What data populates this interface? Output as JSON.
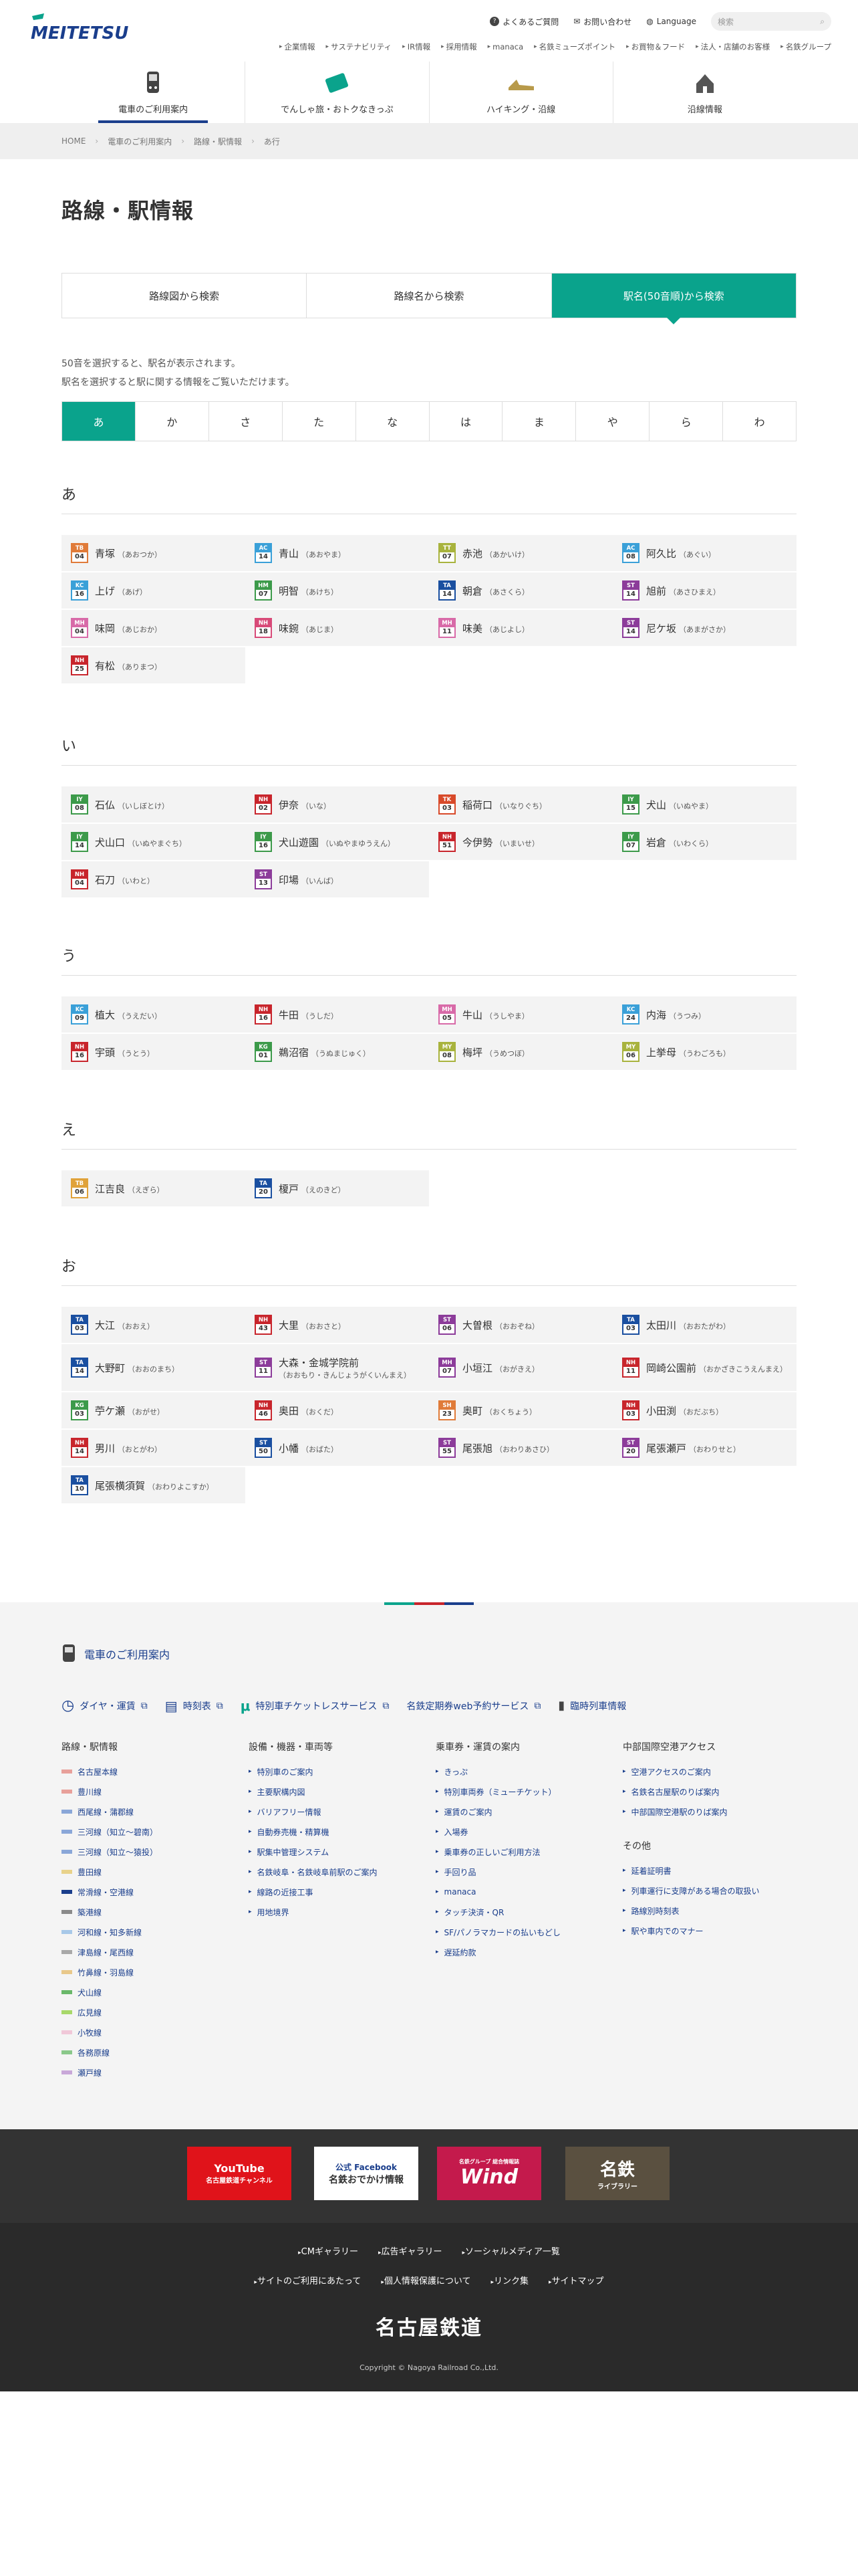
{
  "header": {
    "logo": "MEITETSU",
    "utility": [
      {
        "label": "よくあるご質問",
        "icon": "question-icon"
      },
      {
        "label": "お問い合わせ",
        "icon": "mail-icon"
      },
      {
        "label": "Language",
        "icon": "globe-icon"
      }
    ],
    "search_placeholder": "検索",
    "sublinks": [
      "企業情報",
      "サステナビリティ",
      "IR情報",
      "採用情報",
      "manaca",
      "名鉄ミューズポイント",
      "お買物＆フード",
      "法人・店舗のお客様",
      "名鉄グループ"
    ],
    "gnav": [
      {
        "label": "電車のご利用案内",
        "icon": "train-icon",
        "active": true
      },
      {
        "label": "でんしゃ旅・おトクなきっぷ",
        "icon": "ticket-icon"
      },
      {
        "label": "ハイキング・沿線",
        "icon": "hiking-shoes-icon"
      },
      {
        "label": "沿線情報",
        "icon": "castle-icon"
      }
    ]
  },
  "breadcrumb": [
    "HOME",
    "電車のご利用案内",
    "路線・駅情報",
    "あ行"
  ],
  "page_title": "路線・駅情報",
  "tabs": [
    {
      "label": "路線図から検索"
    },
    {
      "label": "路線名から検索"
    },
    {
      "label": "駅名(50音順)から検索",
      "active": true
    }
  ],
  "description": [
    "50音を選択すると、駅名が表示されます。",
    "駅名を選択すると駅に関する情報をご覧いただけます。"
  ],
  "kana": [
    "あ",
    "か",
    "さ",
    "た",
    "な",
    "は",
    "ま",
    "や",
    "ら",
    "わ"
  ],
  "sections": [
    {
      "heading": "あ",
      "stations": [
        {
          "code": "TB",
          "num": "04",
          "color": "#e07b39",
          "name": "青塚",
          "reading": "（あおつか）"
        },
        {
          "code": "AC",
          "num": "14",
          "color": "#3aa0d8",
          "name": "青山",
          "reading": "（あおやま）"
        },
        {
          "code": "TT",
          "num": "07",
          "color": "#a8b33d",
          "name": "赤池",
          "reading": "（あかいけ）"
        },
        {
          "code": "AC",
          "num": "08",
          "color": "#3aa0d8",
          "name": "阿久比",
          "reading": "（あぐい）"
        },
        {
          "code": "KC",
          "num": "16",
          "color": "#3aa0d8",
          "name": "上げ",
          "reading": "（あげ）"
        },
        {
          "code": "HM",
          "num": "07",
          "color": "#3c9a4a",
          "name": "明智",
          "reading": "（あけち）"
        },
        {
          "code": "TA",
          "num": "14",
          "color": "#1a4fa0",
          "name": "朝倉",
          "reading": "（あさくら）"
        },
        {
          "code": "ST",
          "num": "14",
          "color": "#8c3c9a",
          "name": "旭前",
          "reading": "（あさひまえ）"
        },
        {
          "code": "MH",
          "num": "04",
          "color": "#d86aa8",
          "name": "味岡",
          "reading": "（あじおか）"
        },
        {
          "code": "NH",
          "num": "18",
          "color": "#d84a78",
          "name": "味鋺",
          "reading": "（あじま）"
        },
        {
          "code": "MH",
          "num": "11",
          "color": "#d86aa8",
          "name": "味美",
          "reading": "（あじよし）"
        },
        {
          "code": "ST",
          "num": "14",
          "color": "#8c3c9a",
          "name": "尼ケ坂",
          "reading": "（あまがさか）"
        },
        {
          "code": "NH",
          "num": "25",
          "color": "#c8252c",
          "name": "有松",
          "reading": "（ありまつ）"
        }
      ]
    },
    {
      "heading": "い",
      "stations": [
        {
          "code": "IY",
          "num": "08",
          "color": "#3c9a4a",
          "name": "石仏",
          "reading": "（いしぼとけ）"
        },
        {
          "code": "NH",
          "num": "02",
          "color": "#c8252c",
          "name": "伊奈",
          "reading": "（いな）"
        },
        {
          "code": "TK",
          "num": "03",
          "color": "#d84a2a",
          "name": "稲荷口",
          "reading": "（いなりぐち）"
        },
        {
          "code": "IY",
          "num": "15",
          "color": "#3c9a4a",
          "name": "犬山",
          "reading": "（いぬやま）"
        },
        {
          "code": "IY",
          "num": "14",
          "color": "#3c9a4a",
          "name": "犬山口",
          "reading": "（いぬやまぐち）"
        },
        {
          "code": "IY",
          "num": "16",
          "color": "#3c9a4a",
          "name": "犬山遊園",
          "reading": "（いぬやまゆうえん）"
        },
        {
          "code": "NH",
          "num": "51",
          "color": "#c8252c",
          "name": "今伊勢",
          "reading": "（いまいせ）"
        },
        {
          "code": "IY",
          "num": "07",
          "color": "#3c9a4a",
          "name": "岩倉",
          "reading": "（いわくら）"
        },
        {
          "code": "NH",
          "num": "04",
          "color": "#c8252c",
          "name": "石刀",
          "reading": "（いわと）"
        },
        {
          "code": "ST",
          "num": "13",
          "color": "#8c3c9a",
          "name": "印場",
          "reading": "（いんば）"
        }
      ]
    },
    {
      "heading": "う",
      "stations": [
        {
          "code": "KC",
          "num": "09",
          "color": "#3aa0d8",
          "name": "植大",
          "reading": "（うえだい）"
        },
        {
          "code": "NH",
          "num": "16",
          "color": "#c8252c",
          "name": "牛田",
          "reading": "（うしだ）"
        },
        {
          "code": "MH",
          "num": "05",
          "color": "#d86aa8",
          "name": "牛山",
          "reading": "（うしやま）"
        },
        {
          "code": "KC",
          "num": "24",
          "color": "#3aa0d8",
          "name": "内海",
          "reading": "（うつみ）"
        },
        {
          "code": "NH",
          "num": "16",
          "color": "#c8252c",
          "name": "宇頭",
          "reading": "（うとう）"
        },
        {
          "code": "KG",
          "num": "01",
          "color": "#3c9a4a",
          "name": "鵜沼宿",
          "reading": "（うぬまじゅく）"
        },
        {
          "code": "MY",
          "num": "08",
          "color": "#a8b33d",
          "name": "梅坪",
          "reading": "（うめつぼ）"
        },
        {
          "code": "MY",
          "num": "06",
          "color": "#a8b33d",
          "name": "上挙母",
          "reading": "（うわごろも）"
        }
      ]
    },
    {
      "heading": "え",
      "stations": [
        {
          "code": "TB",
          "num": "06",
          "color": "#e0a23a",
          "name": "江吉良",
          "reading": "（えぎら）"
        },
        {
          "code": "TA",
          "num": "20",
          "color": "#1a4fa0",
          "name": "榎戸",
          "reading": "（えのきど）"
        }
      ]
    },
    {
      "heading": "お",
      "stations": [
        {
          "code": "TA",
          "num": "03",
          "color": "#1a4fa0",
          "name": "大江",
          "reading": "（おおえ）"
        },
        {
          "code": "NH",
          "num": "43",
          "color": "#c8252c",
          "name": "大里",
          "reading": "（おおさと）"
        },
        {
          "code": "ST",
          "num": "06",
          "color": "#8c3c9a",
          "name": "大曽根",
          "reading": "（おおぞね）"
        },
        {
          "code": "TA",
          "num": "03",
          "color": "#1a4fa0",
          "name": "太田川",
          "reading": "（おおたがわ）"
        },
        {
          "code": "TA",
          "num": "14",
          "color": "#1a4fa0",
          "name": "大野町",
          "reading": "（おおのまち）"
        },
        {
          "code": "ST",
          "num": "11",
          "color": "#8c3c9a",
          "name": "大森・金城学院前",
          "reading": "（おおもり・きんじょうがくいんまえ）"
        },
        {
          "code": "MH",
          "num": "07",
          "color": "#8c3c9a",
          "name": "小垣江",
          "reading": "（おがきえ）"
        },
        {
          "code": "NH",
          "num": "11",
          "color": "#c8252c",
          "name": "岡崎公園前",
          "reading": "（おかざきこうえんまえ）"
        },
        {
          "code": "KG",
          "num": "03",
          "color": "#3c9a4a",
          "name": "苧ケ瀬",
          "reading": "（おがせ）"
        },
        {
          "code": "NH",
          "num": "46",
          "color": "#c8252c",
          "name": "奥田",
          "reading": "（おくだ）"
        },
        {
          "code": "SH",
          "num": "23",
          "color": "#e07b39",
          "name": "奥町",
          "reading": "（おくちょう）"
        },
        {
          "code": "NH",
          "num": "03",
          "color": "#c8252c",
          "name": "小田渕",
          "reading": "（おだぶち）"
        },
        {
          "code": "NH",
          "num": "14",
          "color": "#c8252c",
          "name": "男川",
          "reading": "（おとがわ）"
        },
        {
          "code": "ST",
          "num": "50",
          "color": "#1a4fa0",
          "name": "小幡",
          "reading": "（おばた）"
        },
        {
          "code": "ST",
          "num": "55",
          "color": "#8c3c9a",
          "name": "尾張旭",
          "reading": "（おわりあさひ）"
        },
        {
          "code": "ST",
          "num": "20",
          "color": "#8c3c9a",
          "name": "尾張瀬戸",
          "reading": "（おわりせと）"
        },
        {
          "code": "TA",
          "num": "10",
          "color": "#1a4fa0",
          "name": "尾張横須賀",
          "reading": "（おわりよこすか）"
        }
      ]
    }
  ],
  "footer": {
    "category": "電車のご利用案内",
    "links": [
      {
        "label": "ダイヤ・運賃",
        "icon": "clock-icon"
      },
      {
        "label": "時刻表",
        "icon": "timetable-icon"
      },
      {
        "label": "特別車チケットレスサービス",
        "icon": "mu-icon"
      },
      {
        "label": "名鉄定期券web予約サービス",
        "icon": "pass-icon"
      },
      {
        "label": "臨時列車情報",
        "icon": "train-icon"
      }
    ],
    "col1": {
      "title": "路線・駅情報",
      "items": [
        {
          "label": "名古屋本線",
          "color": "#e8a09a"
        },
        {
          "label": "豊川線",
          "color": "#e8a09a"
        },
        {
          "label": "西尾線・蒲郡線",
          "color": "#8aa7d8"
        },
        {
          "label": "三河線（知立〜碧南）",
          "color": "#8aa7d8"
        },
        {
          "label": "三河線（知立〜猿投）",
          "color": "#8aa7d8"
        },
        {
          "label": "豊田線",
          "color": "#e8d28a"
        },
        {
          "label": "常滑線・空港線",
          "color": "#1a3e8c"
        },
        {
          "label": "築港線",
          "color": "#8a8a8a"
        },
        {
          "label": "河和線・知多新線",
          "color": "#a8c8e8"
        },
        {
          "label": "津島線・尾西線",
          "color": "#a8a8a8"
        },
        {
          "label": "竹鼻線・羽島線",
          "color": "#e8c88a"
        },
        {
          "label": "犬山線",
          "color": "#6ab86a"
        },
        {
          "label": "広見線",
          "color": "#a8d86a"
        },
        {
          "label": "小牧線",
          "color": "#f0c8d8"
        },
        {
          "label": "各務原線",
          "color": "#8ac88a"
        },
        {
          "label": "瀬戸線",
          "color": "#c8a8d8"
        }
      ]
    },
    "col2": {
      "title": "設備・機器・車両等",
      "items": [
        "特別車のご案内",
        "主要駅構内図",
        "バリアフリー情報",
        "自動券売機・精算機",
        "駅集中管理システム",
        "名鉄岐阜・名鉄岐阜前駅のご案内",
        "線路の近接工事",
        "用地境界"
      ]
    },
    "col3": {
      "title": "乗車券・運賃の案内",
      "items": [
        "きっぷ",
        "特別車両券（ミューチケット）",
        "運賃のご案内",
        "入場券",
        "乗車券の正しいご利用方法",
        "手回り品",
        "manaca",
        "タッチ決済・QR",
        "SF/パノラマカードの払いもどし",
        "遅延約款"
      ]
    },
    "col4": {
      "title": "中部国際空港アクセス",
      "items": [
        "空港アクセスのご案内",
        "名鉄名古屋駅のりば案内",
        "中部国際空港駅のりば案内"
      ],
      "title2": "その他",
      "items2": [
        "延着証明書",
        "列車運行に支障がある場合の取扱い",
        "路線別時刻表",
        "駅や車内でのマナー"
      ]
    }
  },
  "sns": [
    {
      "label": "YouTube",
      "sub": "名古屋鉄道チャンネル",
      "color": "#e0131a"
    },
    {
      "label": "公式 Facebook",
      "sub": "名鉄おでかけ情報",
      "color": "#fff"
    },
    {
      "label": "Wind",
      "sub": "名鉄グループ 総合情報誌",
      "color": "#c41a4c"
    },
    {
      "label": "名鉄",
      "sub": "ライブラリー",
      "color": "#5a5040"
    }
  ],
  "bottom": {
    "row1": [
      "CMギャラリー",
      "広告ギャラリー",
      "ソーシャルメディア一覧"
    ],
    "row2": [
      "サイトのご利用にあたって",
      "個人情報保護について",
      "リンク集",
      "サイトマップ"
    ],
    "brand": "名古屋鉄道",
    "copyright": "Copyright © Nagoya Railroad Co.,Ltd."
  }
}
